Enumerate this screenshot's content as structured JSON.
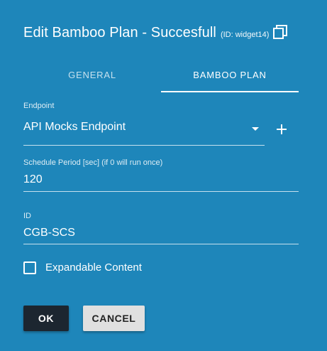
{
  "dialog": {
    "title": "Edit Bamboo Plan - Succesfull",
    "id_note": "(ID: widget14)",
    "copy_icon": "copy-icon"
  },
  "tabs": [
    {
      "label": "GENERAL",
      "active": false
    },
    {
      "label": "BAMBOO PLAN",
      "active": true
    }
  ],
  "form": {
    "endpoint": {
      "label": "Endpoint",
      "value": "API Mocks Endpoint",
      "add_icon": "plus-icon"
    },
    "schedule": {
      "label": "Schedule Period [sec] (if 0 will run once)",
      "value": "120"
    },
    "id": {
      "label": "ID",
      "value": "CGB-SCS"
    },
    "expandable": {
      "label": "Expandable Content",
      "checked": false
    }
  },
  "actions": {
    "ok_label": "OK",
    "cancel_label": "CANCEL"
  },
  "colors": {
    "background": "#1e86ba",
    "ok_button": "#1c2630",
    "cancel_button": "#e0e0e0"
  }
}
